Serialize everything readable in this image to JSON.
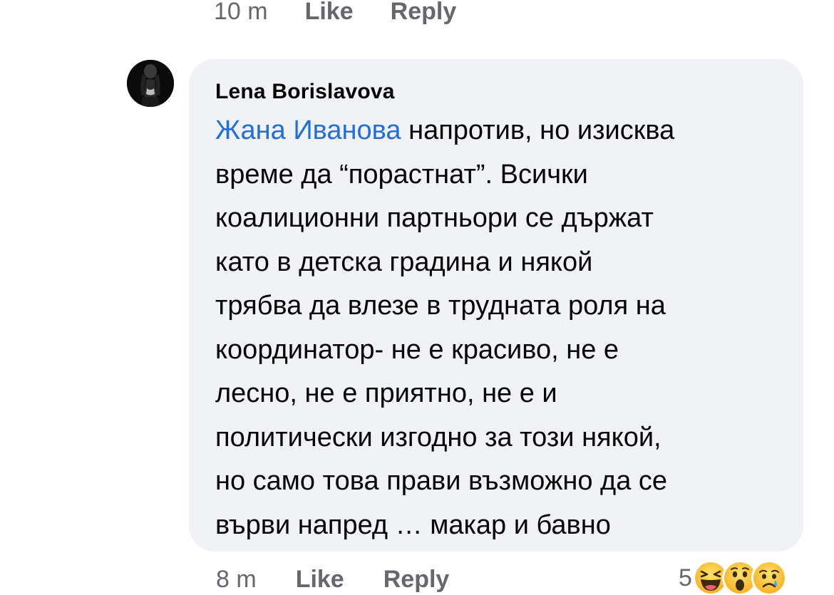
{
  "previous_comment": {
    "time": "10 m",
    "like_label": "Like",
    "reply_label": "Reply"
  },
  "comment": {
    "author": "Lena Borislavova",
    "mention": "Жана Иванова",
    "lines": [
      " напротив, но изисква",
      "време да “порастнат”. Всички",
      "коалиционни партньори се държат",
      "като в детска градина и някой",
      "трябва да влезе в трудната роля на",
      "координатор- не е красиво, не е",
      "лесно, не е приятно, не е и",
      "политически изгодно за този някой,",
      "но само това прави възможно да се",
      "върви напред … макар и бавно"
    ],
    "time": "8 m",
    "like_label": "Like",
    "reply_label": "Reply",
    "reaction_count": "5",
    "reactions": [
      "haha-icon",
      "wow-icon",
      "sad-icon"
    ]
  },
  "colors": {
    "bubble": "#f0f2f5",
    "mention": "#216fdb",
    "meta": "#65676b",
    "text": "#050505"
  }
}
